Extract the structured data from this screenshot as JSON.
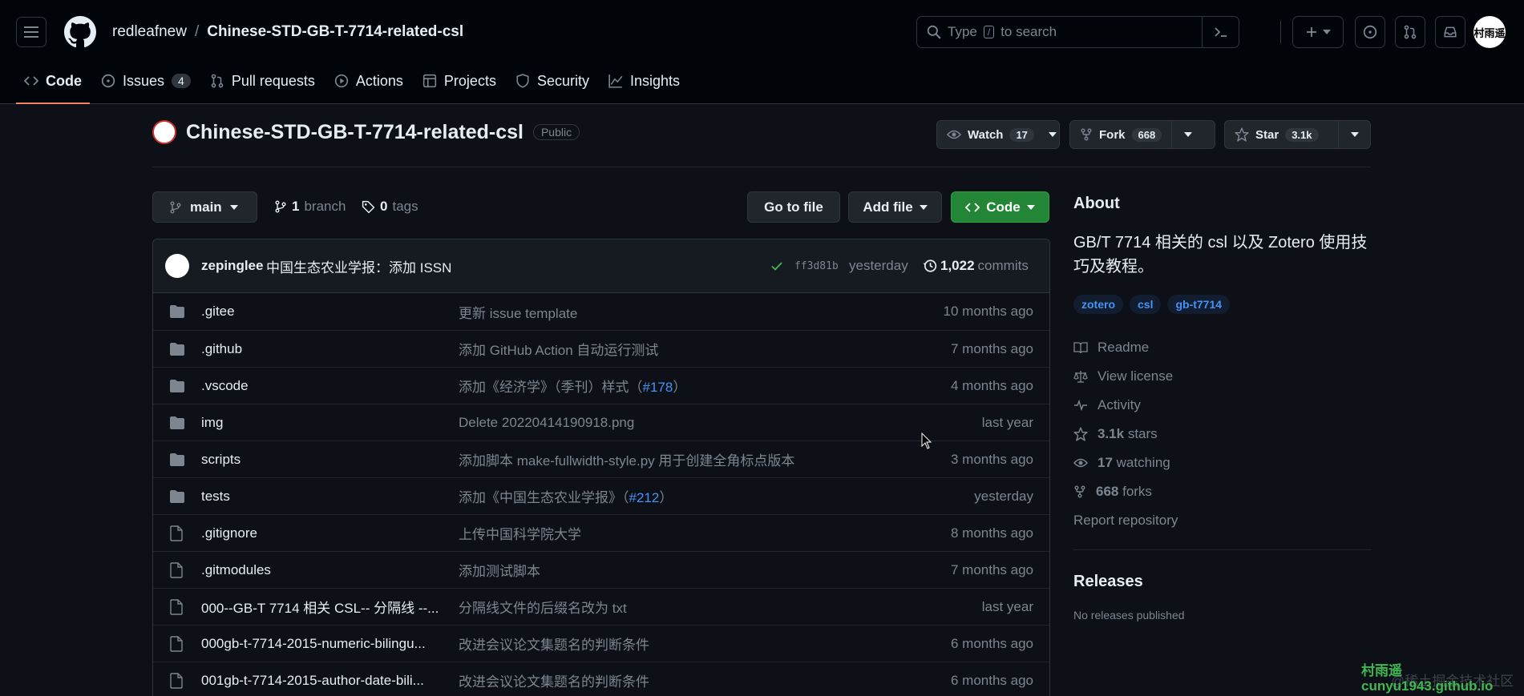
{
  "header": {
    "owner": "redleafnew",
    "separator": "/",
    "repo": "Chinese-STD-GB-T-7714-related-csl",
    "search_placeholder_pre": "Type",
    "search_key": "/",
    "search_placeholder_post": "to search",
    "avatar_text": "村雨遥"
  },
  "nav": {
    "tabs": [
      {
        "label": "Code",
        "icon": "code-icon"
      },
      {
        "label": "Issues",
        "icon": "issue-icon",
        "count": "4"
      },
      {
        "label": "Pull requests",
        "icon": "pull-request-icon"
      },
      {
        "label": "Actions",
        "icon": "play-icon"
      },
      {
        "label": "Projects",
        "icon": "table-icon"
      },
      {
        "label": "Security",
        "icon": "shield-icon"
      },
      {
        "label": "Insights",
        "icon": "graph-icon"
      }
    ]
  },
  "repo": {
    "name": "Chinese-STD-GB-T-7714-related-csl",
    "visibility": "Public",
    "watch_label": "Watch",
    "watch_count": "17",
    "fork_label": "Fork",
    "fork_count": "668",
    "star_label": "Star",
    "star_count": "3.1k"
  },
  "branchbar": {
    "branch": "main",
    "branch_count": "1",
    "branch_word": "branch",
    "tag_count": "0",
    "tag_word": "tags",
    "goto_file": "Go to file",
    "add_file": "Add file",
    "code": "Code"
  },
  "commit": {
    "author": "zepinglee",
    "message": "中国生态农业学报：添加 ISSN",
    "sha": "ff3d81b",
    "time": "yesterday",
    "count": "1,022",
    "count_word": "commits"
  },
  "files": [
    {
      "type": "dir",
      "name": ".gitee",
      "message": "更新 issue template",
      "time": "10 months ago"
    },
    {
      "type": "dir",
      "name": ".github",
      "message": "添加 GitHub Action 自动运行测试",
      "time": "7 months ago"
    },
    {
      "type": "dir",
      "name": ".vscode",
      "message": "添加《经济学》（季刊）样式（",
      "link": "#178",
      "tail": "）",
      "time": "4 months ago"
    },
    {
      "type": "dir",
      "name": "img",
      "message": "Delete 20220414190918.png",
      "time": "last year"
    },
    {
      "type": "dir",
      "name": "scripts",
      "message": "添加脚本 make-fullwidth-style.py 用于创建全角标点版本",
      "time": "3 months ago"
    },
    {
      "type": "dir",
      "name": "tests",
      "message": "添加《中国生态农业学报》（",
      "link": "#212",
      "tail": "）",
      "time": "yesterday"
    },
    {
      "type": "file",
      "name": ".gitignore",
      "message": "上传中国科学院大学",
      "time": "8 months ago"
    },
    {
      "type": "file",
      "name": ".gitmodules",
      "message": "添加测试脚本",
      "time": "7 months ago"
    },
    {
      "type": "file",
      "name": "000--GB-T 7714 相关 CSL-- 分隔线 --...",
      "message": "分隔线文件的后缀名改为 txt",
      "time": "last year"
    },
    {
      "type": "file",
      "name": "000gb-t-7714-2015-numeric-bilingu...",
      "message": "改进会议论文集题名的判断条件",
      "time": "6 months ago"
    },
    {
      "type": "file",
      "name": "001gb-t-7714-2015-author-date-bili...",
      "message": "改进会议论文集题名的判断条件",
      "time": "6 months ago"
    }
  ],
  "about": {
    "title": "About",
    "description": "GB/T 7714 相关的 csl 以及 Zotero 使用技巧及教程。",
    "topics": [
      "zotero",
      "csl",
      "gb-t7714"
    ],
    "links": [
      {
        "icon": "book-icon",
        "pre": "",
        "bold": "",
        "label": "Readme"
      },
      {
        "icon": "law-icon",
        "pre": "",
        "bold": "",
        "label": "View license"
      },
      {
        "icon": "pulse-icon",
        "pre": "",
        "bold": "",
        "label": "Activity"
      },
      {
        "icon": "star-icon",
        "pre": "",
        "bold": "3.1k",
        "label": " stars"
      },
      {
        "icon": "eye-icon",
        "pre": "",
        "bold": "17",
        "label": " watching"
      },
      {
        "icon": "fork-icon",
        "pre": "",
        "bold": "668",
        "label": " forks"
      }
    ],
    "report": "Report repository"
  },
  "releases": {
    "title": "Releases",
    "empty": "No releases published"
  },
  "watermark": {
    "line1": "村雨遥",
    "line2": "cunyu1943.github.io",
    "line3": "@稀土掘金技术社区"
  }
}
